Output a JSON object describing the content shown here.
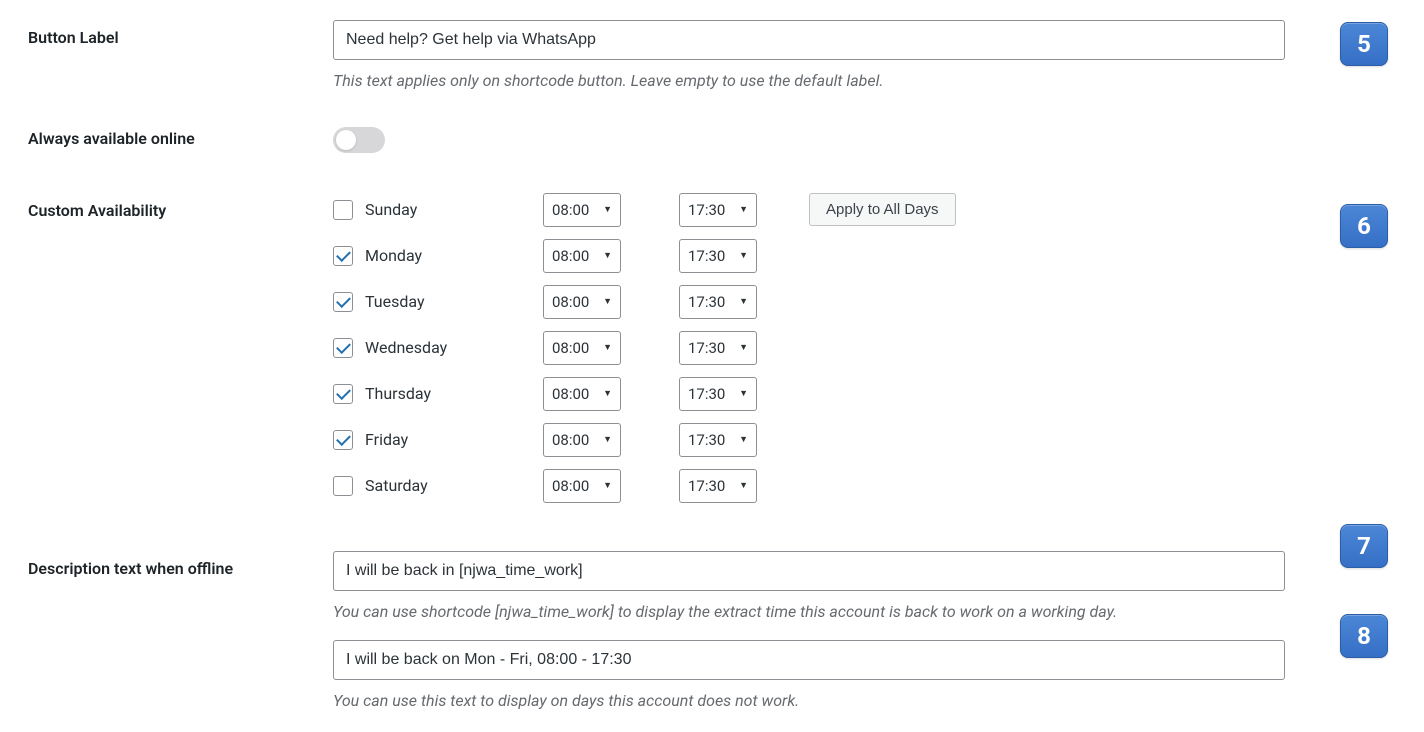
{
  "labels": {
    "button_label": "Button Label",
    "always_available": "Always available online",
    "custom_availability": "Custom Availability",
    "offline_desc": "Description text when offline"
  },
  "button_label": {
    "value": "Need help? Get help via WhatsApp",
    "help": "This text applies only on shortcode button. Leave empty to use the default label."
  },
  "always_available": {
    "on": false
  },
  "availability": {
    "apply_all": "Apply to All Days",
    "days": [
      {
        "name": "Sunday",
        "checked": false,
        "start": "08:00",
        "end": "17:30"
      },
      {
        "name": "Monday",
        "checked": true,
        "start": "08:00",
        "end": "17:30"
      },
      {
        "name": "Tuesday",
        "checked": true,
        "start": "08:00",
        "end": "17:30"
      },
      {
        "name": "Wednesday",
        "checked": true,
        "start": "08:00",
        "end": "17:30"
      },
      {
        "name": "Thursday",
        "checked": true,
        "start": "08:00",
        "end": "17:30"
      },
      {
        "name": "Friday",
        "checked": true,
        "start": "08:00",
        "end": "17:30"
      },
      {
        "name": "Saturday",
        "checked": false,
        "start": "08:00",
        "end": "17:30"
      }
    ]
  },
  "offline": {
    "value1": "I will be back in [njwa_time_work]",
    "help1": "You can use shortcode [njwa_time_work] to display the extract time this account is back to work on a working day.",
    "value2": "I will be back on Mon - Fri, 08:00 - 17:30",
    "help2": "You can use this text to display on days this account does not work."
  },
  "callouts": {
    "c5": "5",
    "c6": "6",
    "c7": "7",
    "c8": "8"
  }
}
